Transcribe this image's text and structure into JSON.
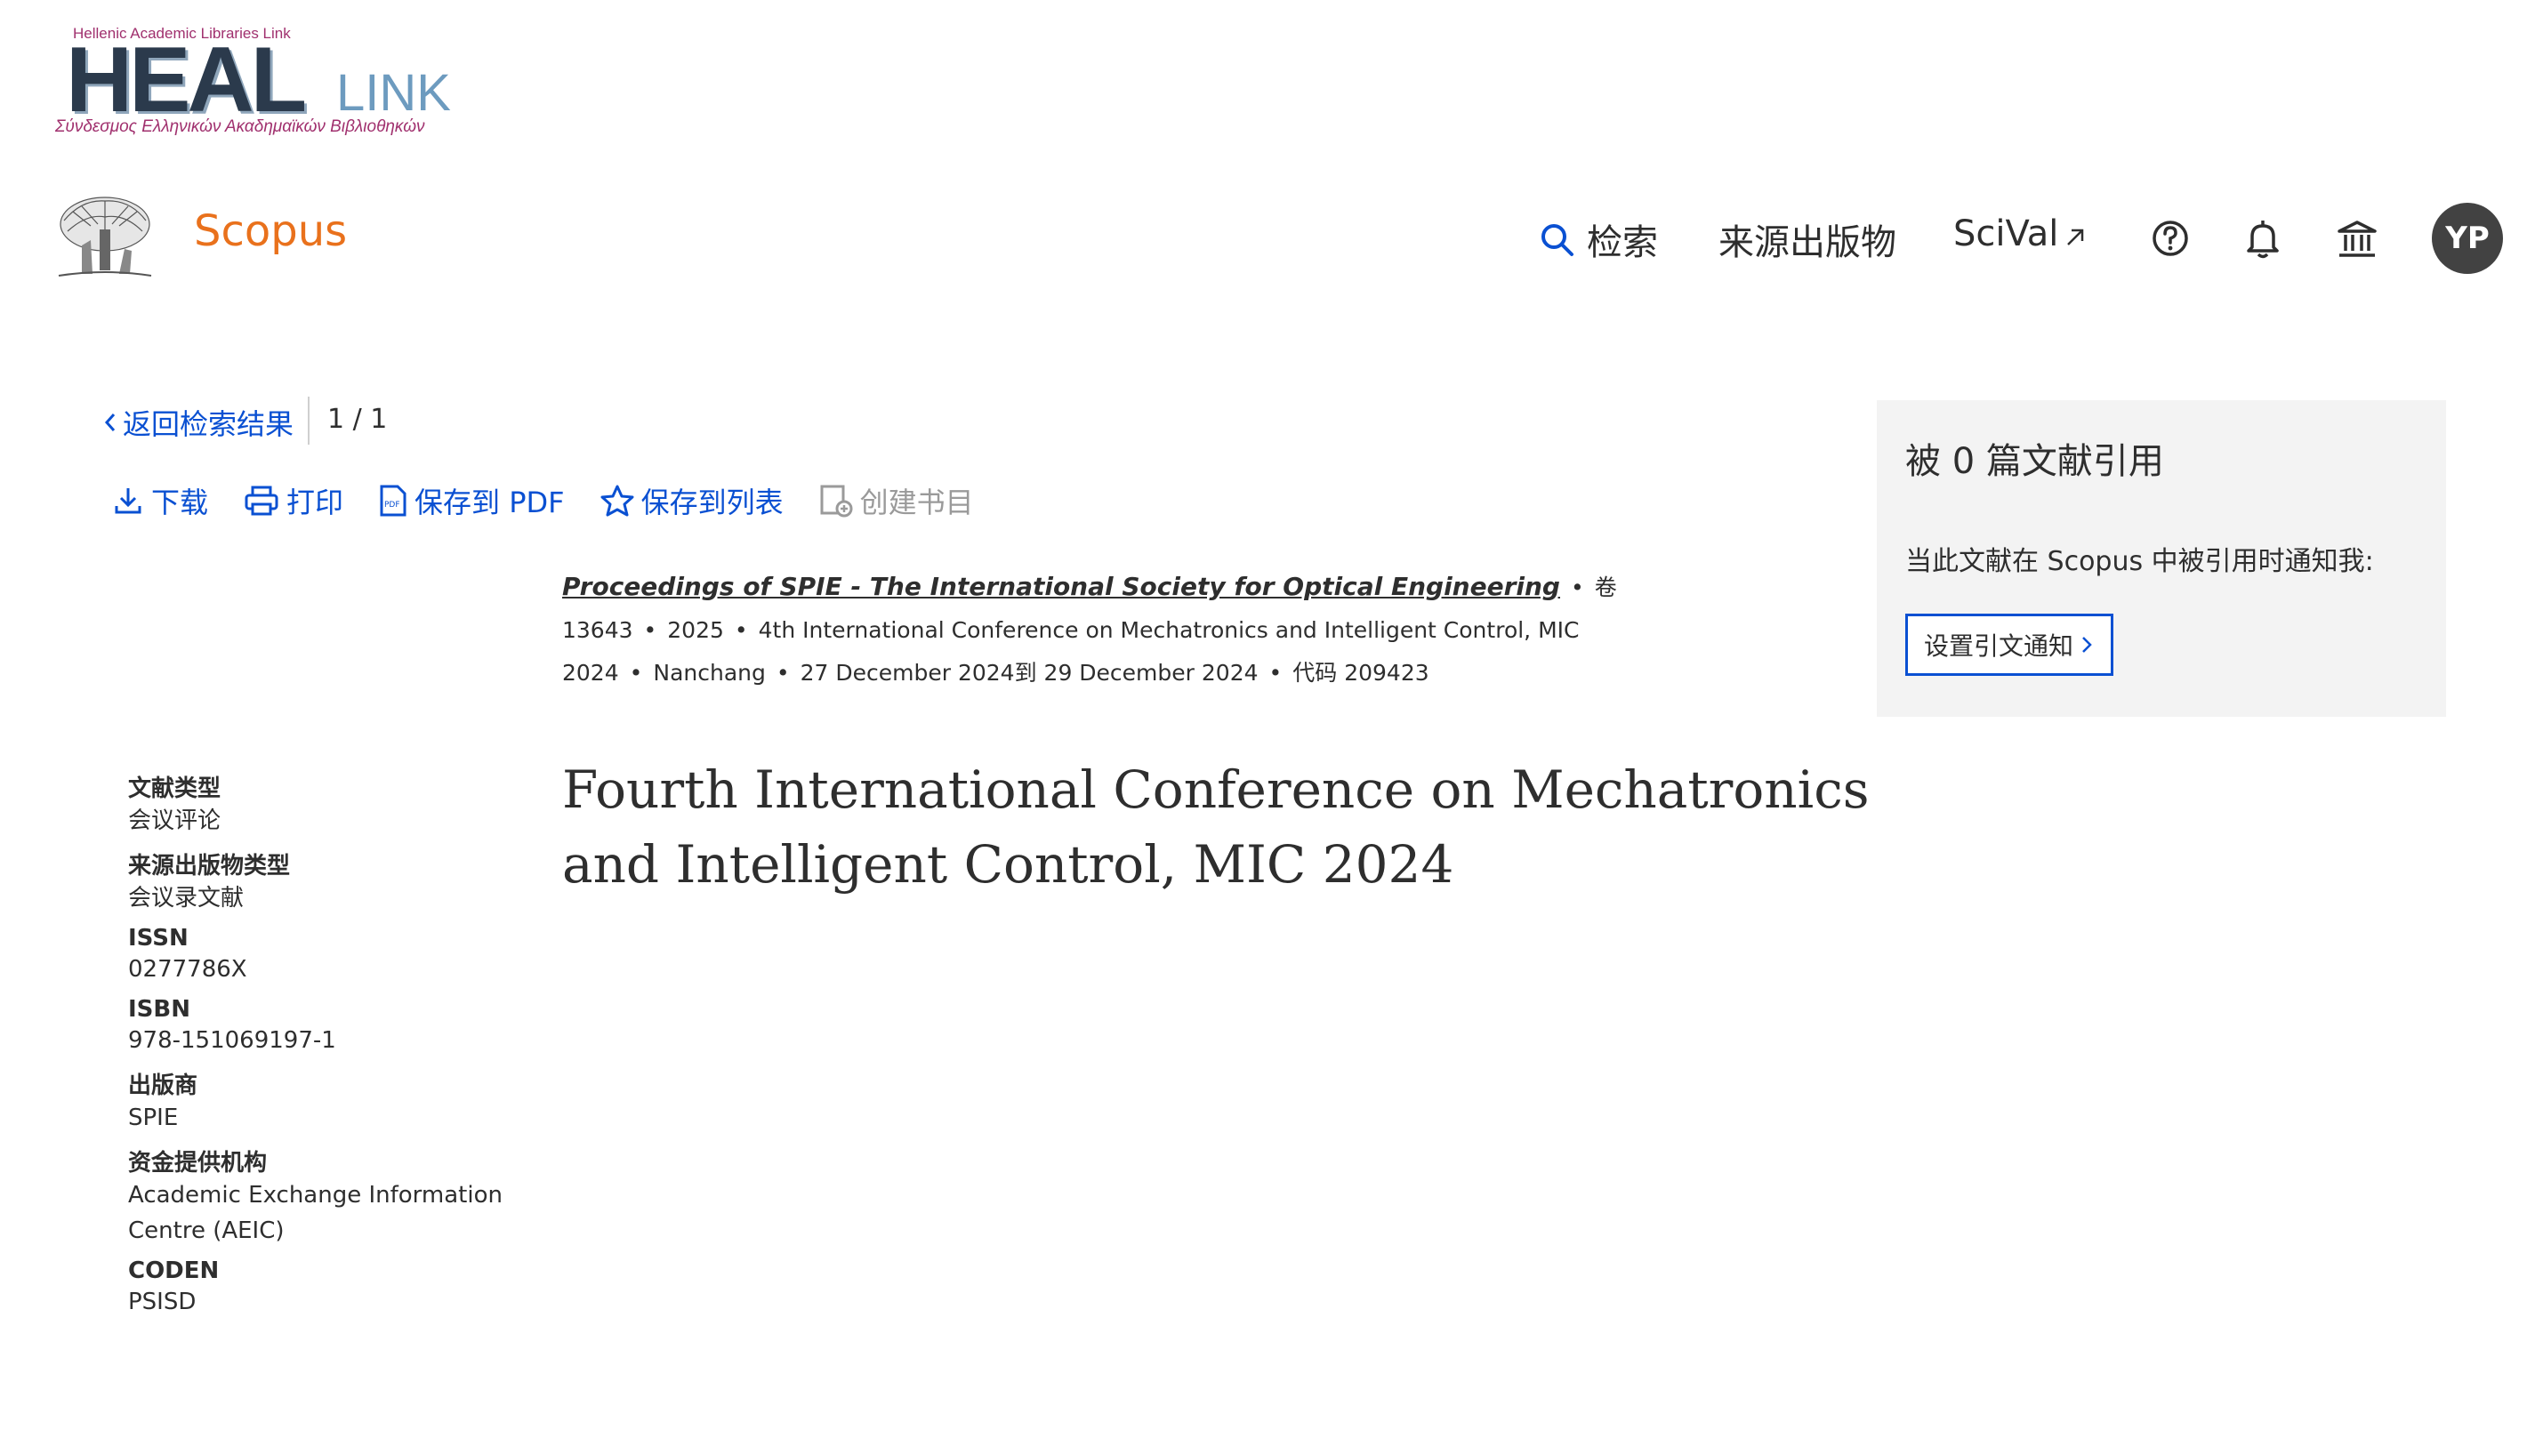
{
  "colors": {
    "link_blue": "#0a50d2",
    "scopus_orange": "#e9711c",
    "avatar_bg": "#424242",
    "panel_bg": "#f3f3f3"
  },
  "heal_logo": {
    "top_text": "Hellenic Academic Libraries Link",
    "big_text": "HEAL",
    "link_text": "LINK",
    "sub_text": "Σύνδεσμος Ελληνικών Ακαδημαϊκών Βιβλιοθηκών"
  },
  "header": {
    "brand": "Scopus",
    "nav": {
      "search": "检索",
      "sources": "来源出版物",
      "scival": "SciVal"
    },
    "icons": [
      "help-icon",
      "bell-icon",
      "institution-icon"
    ],
    "avatar_initials": "YP"
  },
  "navigation": {
    "back_label": "返回检索结果",
    "pager": "1 / 1"
  },
  "toolbar": {
    "download": "下载",
    "print": "打印",
    "save_pdf": "保存到 PDF",
    "save_list": "保存到列表",
    "create_bib": "创建书目"
  },
  "source": {
    "title": "Proceedings of SPIE - The International Society for Optical Engineering",
    "volume": "卷 13643",
    "year": "2025",
    "conference": "4th International Conference on Mechatronics and Intelligent Control, MIC 2024",
    "location": "Nanchang",
    "dates": "27 December 2024到 29 December 2024",
    "code": "代码 209423"
  },
  "document": {
    "title": "Fourth International Conference on Mechatronics and Intelligent Control, MIC 2024"
  },
  "metadata": [
    {
      "label": "文献类型",
      "value": "会议评论"
    },
    {
      "label": "来源出版物类型",
      "value": "会议录文献"
    },
    {
      "label": "ISSN",
      "value": "0277786X"
    },
    {
      "label": "ISBN",
      "value": "978-151069197-1"
    },
    {
      "label": "出版商",
      "value": "SPIE"
    },
    {
      "label": "资金提供机构",
      "value": "Academic Exchange Information Centre (AEIC)"
    },
    {
      "label": "CODEN",
      "value": "PSISD"
    }
  ],
  "citations": {
    "count_text": "被 0 篇文献引用",
    "alert_text": "当此文献在 Scopus 中被引用时通知我:",
    "button_label": "设置引文通知"
  }
}
